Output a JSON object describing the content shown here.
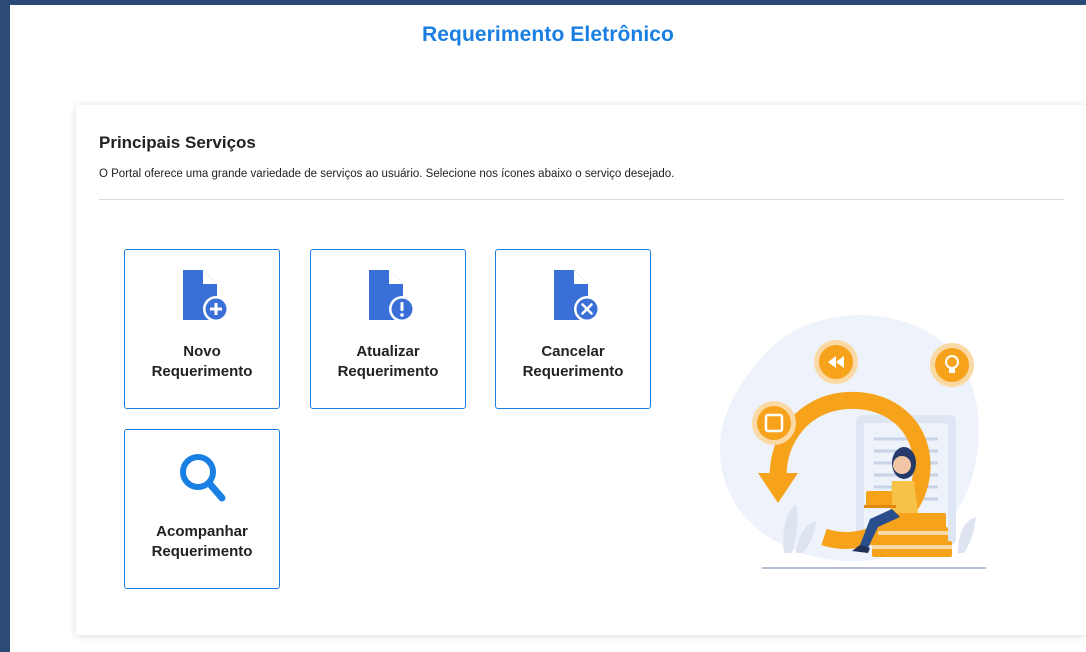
{
  "header": {
    "title": "Requerimento Eletrônico"
  },
  "services": {
    "title": "Principais Serviços",
    "description": "O Portal oferece uma grande variedade de serviços ao usuário. Selecione nos ícones abaixo o serviço desejado.",
    "items": [
      {
        "line1": "Novo",
        "line2": "Requerimento",
        "icon": "file-plus-icon"
      },
      {
        "line1": "Atualizar",
        "line2": "Requerimento",
        "icon": "file-alert-icon"
      },
      {
        "line1": "Cancelar",
        "line2": "Requerimento",
        "icon": "file-cancel-icon"
      },
      {
        "line1": "Acompanhar",
        "line2": "Requerimento",
        "icon": "search-icon"
      }
    ]
  },
  "colors": {
    "accent": "#1a7fe3",
    "icon": "#3a6fd8",
    "border": "#2b4a78",
    "illustration_orange": "#f7a21b"
  }
}
